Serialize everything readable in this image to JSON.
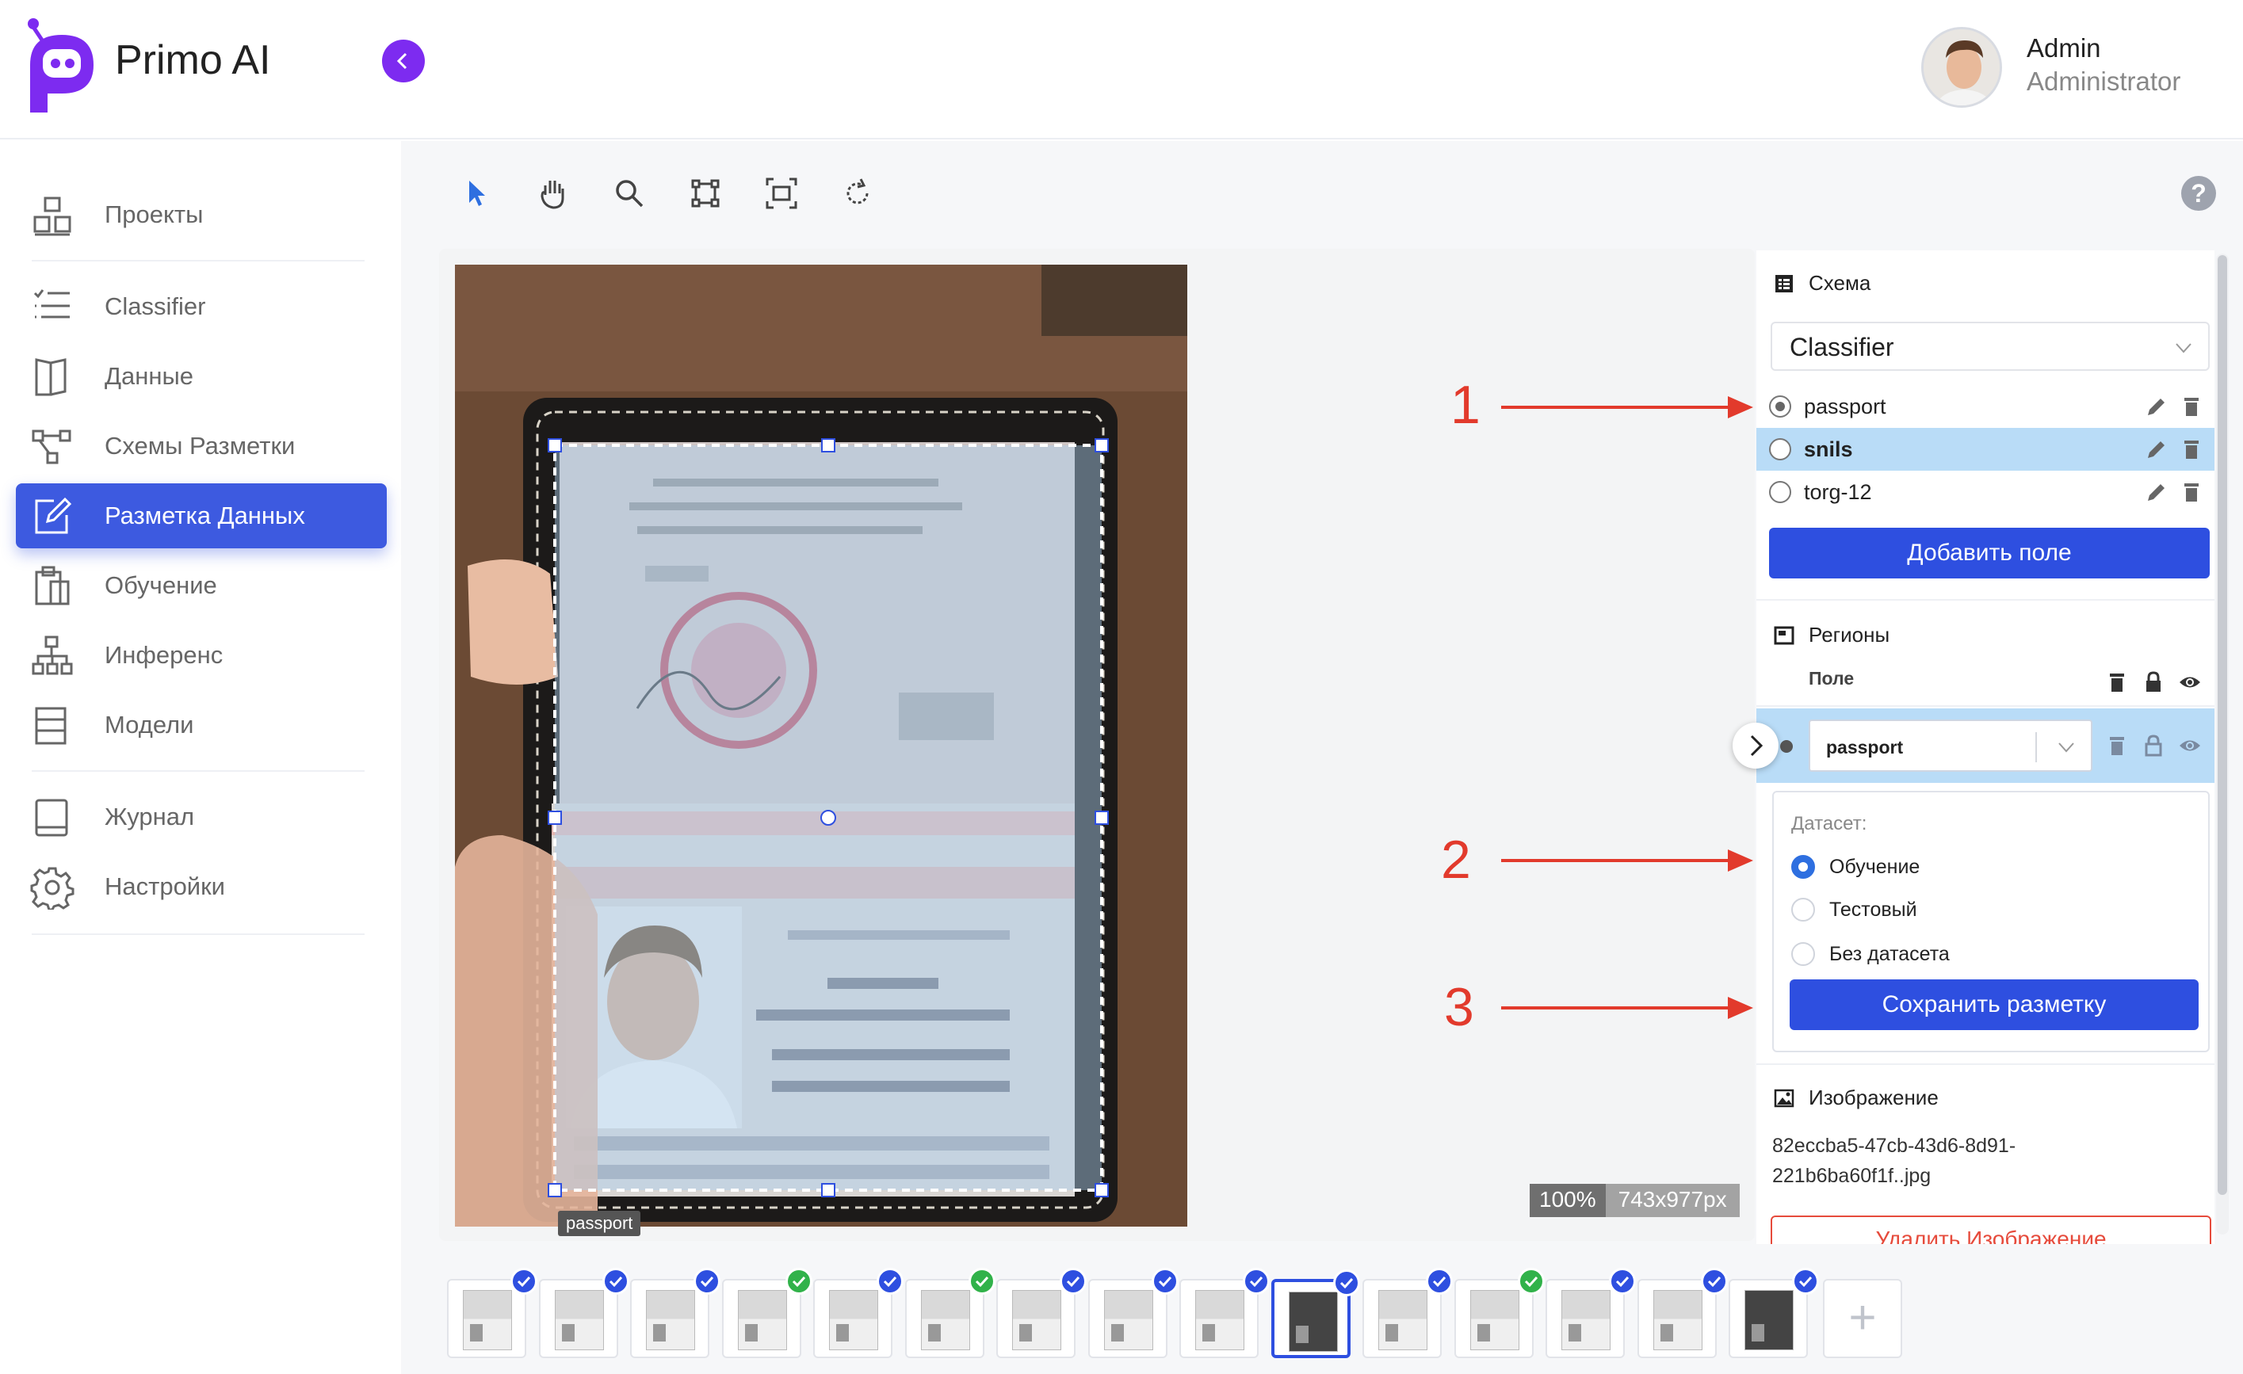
{
  "app": {
    "title": "Primo AI"
  },
  "user": {
    "name": "Admin",
    "role": "Administrator"
  },
  "sidebar": {
    "items": [
      {
        "label": "Проекты",
        "icon": "projects-icon"
      },
      {
        "label": "Classifier",
        "icon": "list-icon"
      },
      {
        "label": "Данные",
        "icon": "book-open-icon"
      },
      {
        "label": "Схемы Разметки",
        "icon": "schema-icon"
      },
      {
        "label": "Разметка Данных",
        "icon": "edit-icon",
        "active": true
      },
      {
        "label": "Обучение",
        "icon": "clipboard-icon"
      },
      {
        "label": "Инференс",
        "icon": "hierarchy-icon"
      },
      {
        "label": "Модели",
        "icon": "layers-icon"
      },
      {
        "label": "Журнал",
        "icon": "journal-icon"
      },
      {
        "label": "Настройки",
        "icon": "gear-icon"
      }
    ]
  },
  "toolbar": {
    "tools": [
      "pointer-icon",
      "hand-icon",
      "zoom-icon",
      "bbox-icon",
      "fit-icon",
      "rotate-icon"
    ]
  },
  "canvas": {
    "zoom": "100%",
    "size": "743x977px",
    "region_label": "passport"
  },
  "panel": {
    "schema": {
      "title": "Схема",
      "selected": "Classifier",
      "fields": [
        {
          "label": "passport",
          "checked": true
        },
        {
          "label": "snils",
          "selected": true
        },
        {
          "label": "torg-12"
        }
      ],
      "add_button": "Добавить поле"
    },
    "regions": {
      "title": "Регионы",
      "column": "Поле",
      "region_value": "passport"
    },
    "dataset": {
      "title": "Датасет:",
      "options": [
        "Обучение",
        "Тестовый",
        "Без датасета"
      ],
      "selected": "Обучение",
      "save_button": "Сохранить разметку"
    },
    "image": {
      "title": "Изображение",
      "filename_line1": "82eccba5-47cb-43d6-8d91-",
      "filename_line2": "221b6ba60f1f..jpg",
      "delete_button": "Удалить Изображение"
    }
  },
  "annotations": [
    "1",
    "2",
    "3"
  ],
  "thumbnails": {
    "status": [
      "blue",
      "blue",
      "blue",
      "green",
      "blue",
      "green",
      "blue",
      "blue",
      "blue",
      "blue",
      "blue",
      "green",
      "blue",
      "blue",
      "blue"
    ],
    "current_index": 9,
    "add_label": "+"
  },
  "colors": {
    "accent": "#2e4fe0",
    "sidebar_active": "#3d5ae0",
    "logo": "#7d2bf0",
    "selection": "#b9dcf7",
    "annotation": "#e23a2c",
    "done_green": "#31b24a"
  }
}
